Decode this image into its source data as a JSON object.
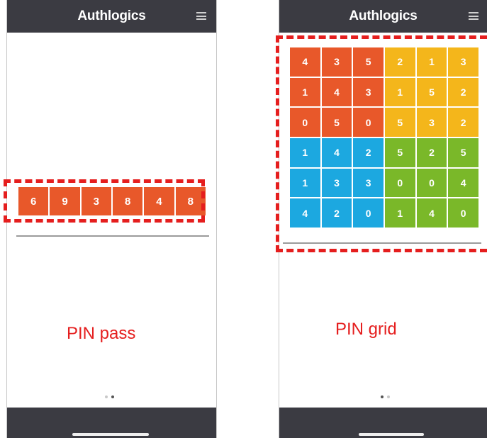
{
  "app": {
    "brand": "Authlogics"
  },
  "pin_pass": {
    "digits": [
      "6",
      "9",
      "3",
      "8",
      "4",
      "8"
    ],
    "color": "#e8582a",
    "caption": "PIN pass"
  },
  "pin_grid": {
    "caption": "PIN grid",
    "colors": {
      "top_left": "#e8582a",
      "top_right": "#f4b61b",
      "bottom_left": "#1ca8e0",
      "bottom_right": "#7ab829"
    },
    "rows": [
      [
        "4",
        "3",
        "5",
        "2",
        "1",
        "3"
      ],
      [
        "1",
        "4",
        "3",
        "1",
        "5",
        "2"
      ],
      [
        "0",
        "5",
        "0",
        "5",
        "3",
        "2"
      ],
      [
        "1",
        "4",
        "2",
        "5",
        "2",
        "5"
      ],
      [
        "1",
        "3",
        "3",
        "0",
        "0",
        "4"
      ],
      [
        "4",
        "2",
        "0",
        "1",
        "4",
        "0"
      ]
    ]
  },
  "highlight_color": "#e51e1e"
}
